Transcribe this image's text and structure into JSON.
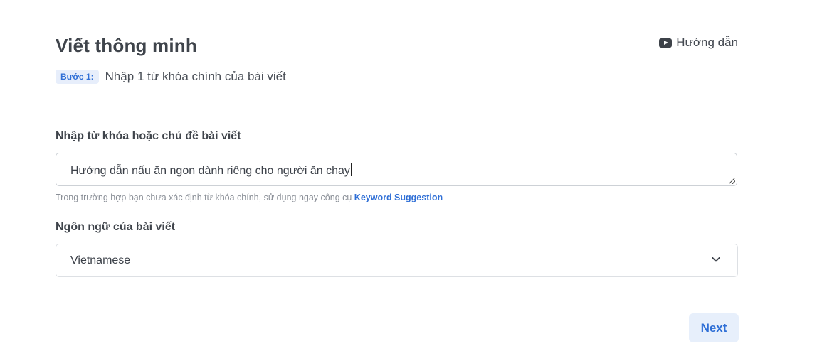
{
  "header": {
    "title": "Viết thông minh",
    "guide_label": "Hướng dẫn",
    "guide_icon": "youtube-play-icon"
  },
  "step": {
    "badge": "Bước 1:",
    "text": "Nhập 1 từ khóa chính của bài viết"
  },
  "keyword": {
    "label": "Nhập từ khóa hoặc chủ đề bài viết",
    "value": "Hướng dẫn nấu ăn ngon dành riêng cho người ăn chay",
    "hint_text": "Trong trường hợp bạn chưa xác định từ khóa chính, sử dụng ngay công cụ ",
    "hint_link": "Keyword Suggestion"
  },
  "language": {
    "label": "Ngôn ngữ của bài viết",
    "selected": "Vietnamese",
    "icon": "chevron-down-icon"
  },
  "actions": {
    "next_label": "Next"
  },
  "colors": {
    "accent": "#2f6fd6",
    "badge_bg": "#e7eefb",
    "text": "#3c4149"
  }
}
